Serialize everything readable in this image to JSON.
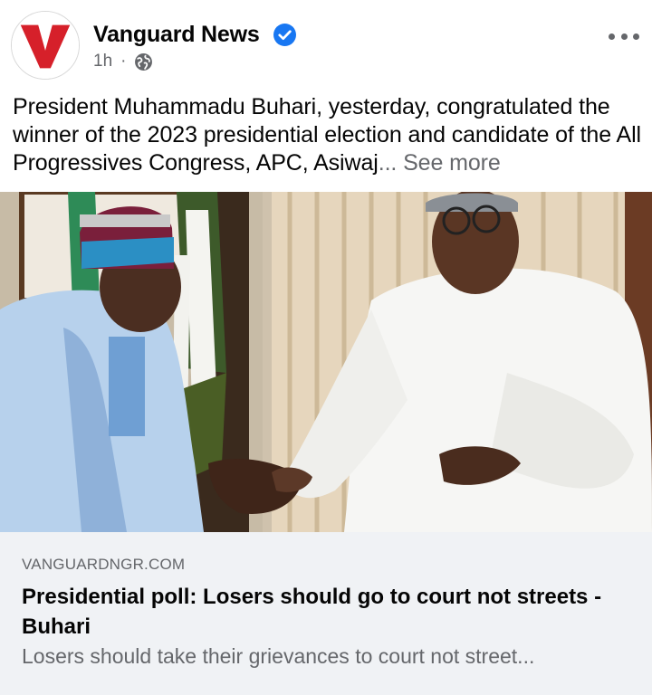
{
  "post": {
    "page_name": "Vanguard News",
    "logo_letter": "V",
    "verified_icon": "verified-badge-icon",
    "time": "1h",
    "separator": "·",
    "audience_icon": "globe-icon",
    "caption": "President Muhammadu Buhari, yesterday, congratulated the winner of the 2023 presidential election and candidate of the All Progressives Congress, APC, Asiwaj",
    "see_more": "... See more"
  },
  "link_preview": {
    "domain": "VANGUARDNGR.COM",
    "title": "Presidential poll: Losers should go to court not streets - Buhari",
    "description": "Losers should take their grievances to court not street..."
  },
  "colors": {
    "brand_red": "#d6202a",
    "verified_blue": "#1877f2",
    "secondary_text": "#65676b",
    "card_background": "#f0f2f5"
  }
}
